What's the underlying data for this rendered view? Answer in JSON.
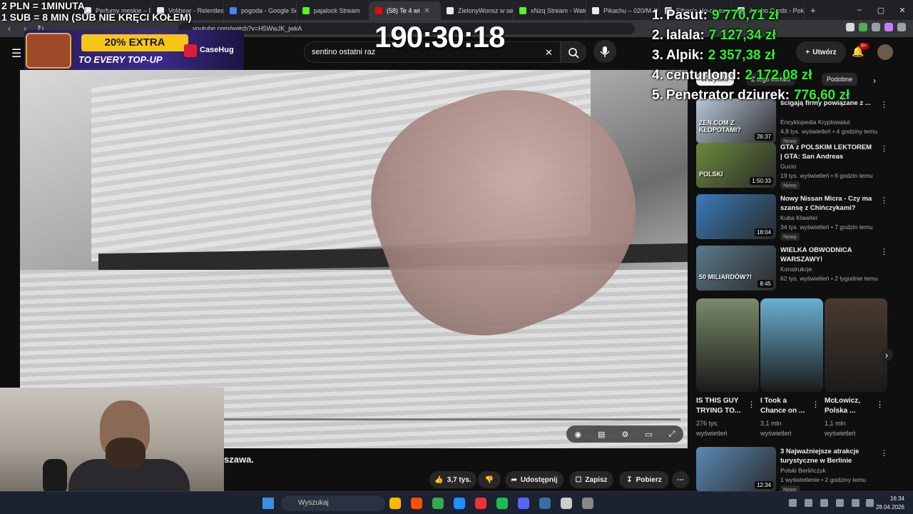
{
  "browser": {
    "tabs": [
      {
        "label": "Perfumy męskie – Fi",
        "color": "#e8eaed"
      },
      {
        "label": "Volibear - Relentles",
        "color": "#e8eaed"
      },
      {
        "label": "pogoda - Google Se",
        "color": "#4285f4"
      },
      {
        "label": "pajalock Stream",
        "color": "#53fc18"
      },
      {
        "label": "(58) Te 4 wi",
        "color": "#ff0000",
        "active": true
      },
      {
        "label": "ZielonyWonsz w ser",
        "color": "#e8eaed"
      },
      {
        "label": "xNzq Stream - Watc",
        "color": "#53fc18"
      },
      {
        "label": "Pikachu – 020/M-D",
        "color": "#e8eaed"
      },
      {
        "label": "Ethan's Ho-oh ex",
        "color": "#e8eaed"
      },
      {
        "label": "Jumbo Cards - Poké",
        "color": "#e8eaed"
      }
    ],
    "url": "youtube.com/watch?v=H5WwJK_jwkA"
  },
  "youtube": {
    "search_query": "sentino ostatni raz",
    "create_label": "Utwórz",
    "notification_count": "9+",
    "chips": [
      "Wszystko",
      "Z tego kanału",
      "Podobne"
    ],
    "video_title_fragment": "szawa.",
    "actions": {
      "like_count": "3,7 tys.",
      "share": "Udostępnij",
      "save": "Zapisz",
      "download": "Pobierz"
    },
    "recommendations": [
      {
        "title": "ścigają firmy powiązane z ...",
        "channel": "Encyklopedia Kryptowalut",
        "meta": "4,8 tys. wyświetleń • 4 godziny temu",
        "badge": "Nowy",
        "duration": "26:37",
        "thumb_color": "#b8c9d8",
        "thumb_text": "ZEN.COM Z KŁOPOTAMI?"
      },
      {
        "title": "GTA z POLSKIM LEKTOREM | GTA: San Andreas",
        "channel": "Gucio",
        "meta": "19 tys. wyświetleń • 6 godzin temu",
        "badge": "Nowy",
        "duration": "1:50:33",
        "thumb_color": "#6a8a3a",
        "thumb_text": "POLSKI"
      },
      {
        "title": "Nowy Nissan Micra - Czy ma szansę z Chińczykami?",
        "channel": "Kuba Klawiter",
        "meta": "34 tys. wyświetleń • 7 godzin temu",
        "badge": "Nowy",
        "duration": "18:04",
        "thumb_color": "#3a7ab8",
        "thumb_text": ""
      },
      {
        "title": "WIELKA OBWODNICA WARSZAWY!",
        "channel": "Konstrukcje",
        "meta": "62 tys. wyświetleń • 2 tygodnie temu",
        "badge": "",
        "duration": "8:45",
        "thumb_color": "#5a7a8a",
        "thumb_text": "50 MILIARDÓW?!"
      }
    ],
    "shorts": [
      {
        "title": "IS THIS GUY TRYING TO...",
        "views": "276 tys. wyświetleń",
        "color": "#7a8a6a"
      },
      {
        "title": "I Took a Chance on ...",
        "views": "3,1 mln wyświetleń",
        "color": "#6ab0d0"
      },
      {
        "title": "McŁowicz, Polska ...",
        "views": "1,1 mln wyświetleń",
        "color": "#4a3a30"
      }
    ],
    "last_rec": {
      "title": "3 Najważniejsze atrakcje turystyczne w Berlinie",
      "channel": "Polski Berlińczyk",
      "meta": "1 wyświetlenie • 2 godziny temu",
      "badge": "Nowy",
      "duration": "12:34",
      "thumb_color": "#5a8ab8"
    }
  },
  "overlay": {
    "donation_line1": "2 PLN = 1MINUTA",
    "donation_line2": "1 SUB = 8 MIN (SUB NIE KRĘCI KOŁEM)",
    "timer": "190:30:18",
    "ad": {
      "headline": "20% EXTRA",
      "sub": "TO EVERY TOP-UP",
      "brand": "CaseHug"
    },
    "leaderboard": [
      {
        "rank": "1.",
        "name": "Pasut:",
        "amount": "9 770,71 zł"
      },
      {
        "rank": "2.",
        "name": "lalala:",
        "amount": "7 127,34 zł"
      },
      {
        "rank": "3.",
        "name": "Alpik:",
        "amount": "2 357,38 zł"
      },
      {
        "rank": "4.",
        "name": "centurlond:",
        "amount": "2 172,08 zł"
      },
      {
        "rank": "5.",
        "name": "Penetrator dziurek:",
        "amount": "776,60 zł"
      }
    ]
  },
  "taskbar": {
    "search_placeholder": "Wyszukaj",
    "time": "16:34",
    "date": "28.04.2026",
    "apps": [
      "#ffb900",
      "#ff5000",
      "#34a853",
      "#1e90ff",
      "#e33",
      "#1db954",
      "#5865f2",
      "#3a6ea5",
      "#ccc",
      "#888"
    ]
  }
}
